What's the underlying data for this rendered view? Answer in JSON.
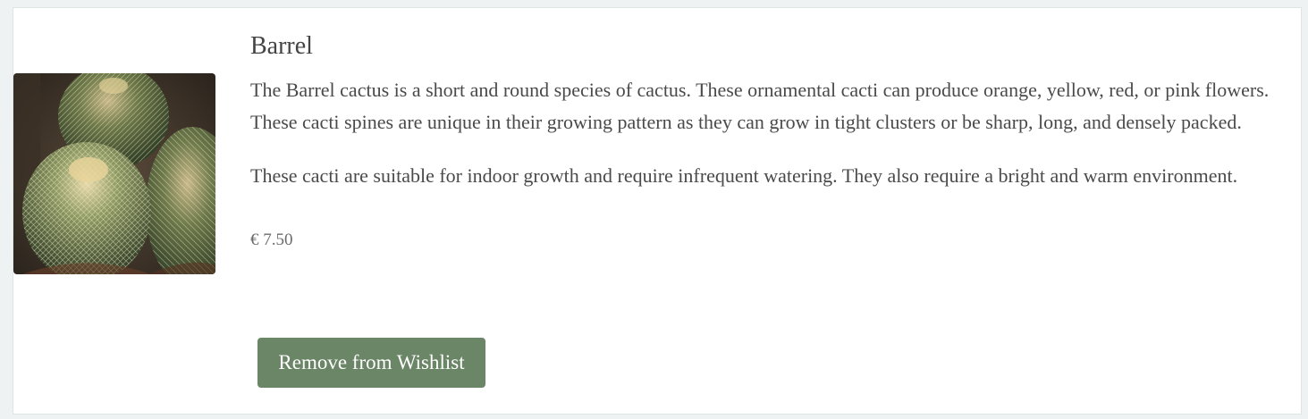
{
  "product": {
    "name": "Barrel",
    "image_alt": "Barrel cactus plants",
    "description_1": "The Barrel cactus is a short and round species of cactus. These ornamental cacti can produce orange, yellow, red, or pink flowers. These cacti spines are unique in their growing pattern as they can grow in tight clusters or be sharp, long, and densely packed.",
    "description_2": "These cacti are suitable for indoor growth and require infrequent watering. They also require a bright and warm environment.",
    "price": "€ 7.50"
  },
  "actions": {
    "remove_label": "Remove from Wishlist"
  },
  "colors": {
    "button_bg": "#6b8567",
    "page_bg": "#eef2f2"
  }
}
